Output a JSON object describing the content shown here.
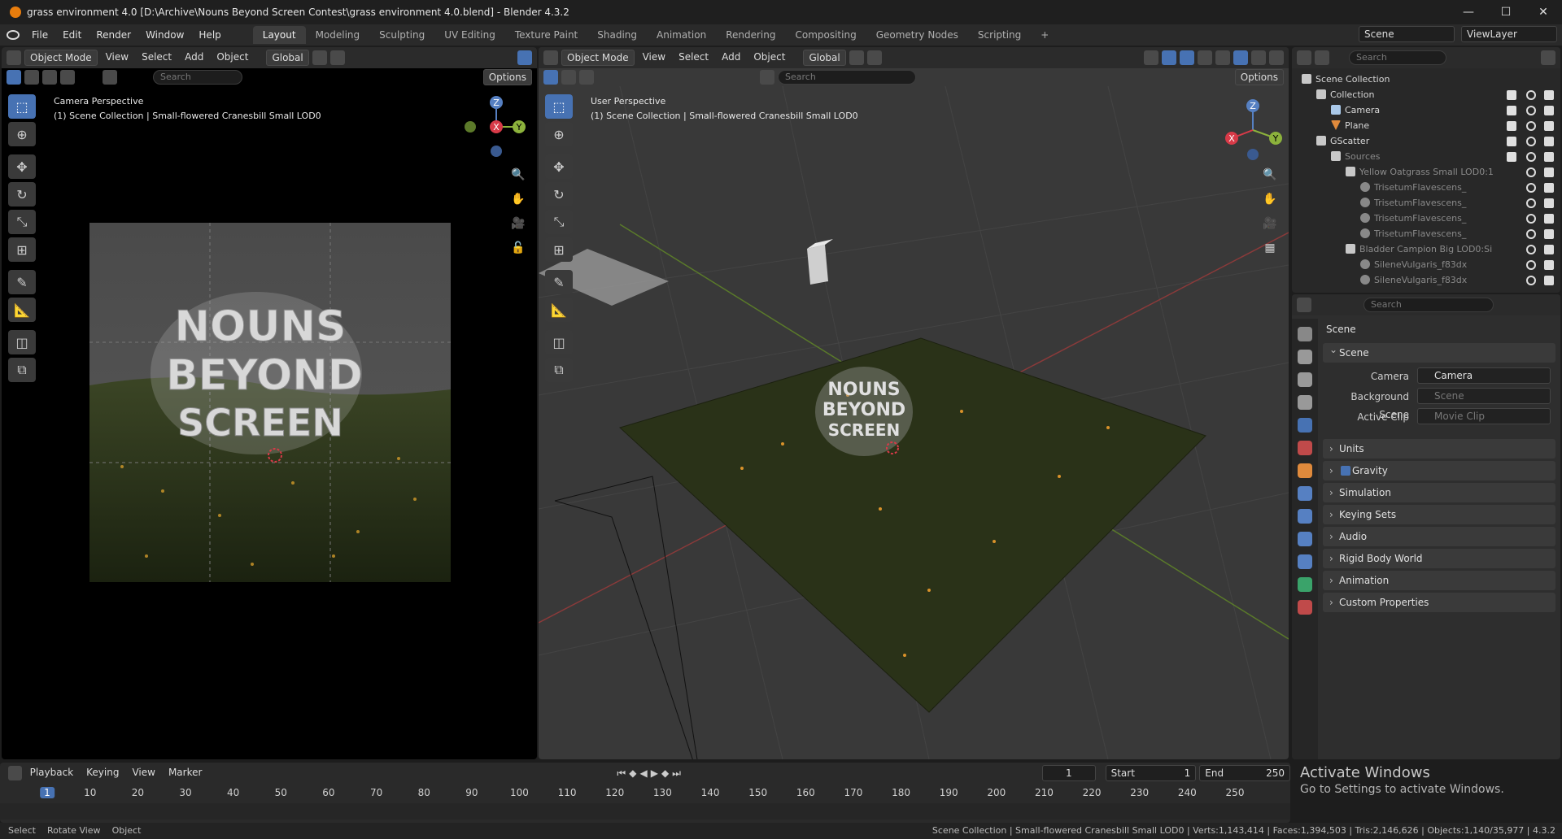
{
  "window": {
    "title": "grass environment 4.0 [D:\\Archive\\Nouns Beyond Screen Contest\\grass environment 4.0.blend] - Blender 4.3.2",
    "minimize": "—",
    "maximize": "☐",
    "close": "✕"
  },
  "menu": [
    "File",
    "Edit",
    "Render",
    "Window",
    "Help"
  ],
  "workspaces": [
    "Layout",
    "Modeling",
    "Sculpting",
    "UV Editing",
    "Texture Paint",
    "Shading",
    "Animation",
    "Rendering",
    "Compositing",
    "Geometry Nodes",
    "Scripting"
  ],
  "workspace_add": "+",
  "scene_field": "Scene",
  "viewlayer_field": "ViewLayer",
  "left_viewport": {
    "mode": "Object Mode",
    "menus": [
      "View",
      "Select",
      "Add",
      "Object"
    ],
    "orientation": "Global",
    "search_placeholder": "Search",
    "options": "Options",
    "perspective": "Camera Perspective",
    "context": "(1) Scene Collection | Small-flowered Cranesbill Small LOD0",
    "gizmo": {
      "z": "Z",
      "y": "Y",
      "x": "X"
    }
  },
  "right_viewport": {
    "mode": "Object Mode",
    "menus": [
      "View",
      "Select",
      "Add",
      "Object"
    ],
    "orientation": "Global",
    "search_placeholder": "Search",
    "options": "Options",
    "perspective": "User Perspective",
    "context": "(1) Scene Collection | Small-flowered Cranesbill Small LOD0",
    "gizmo": {
      "z": "Z",
      "y": "Y",
      "x": "X"
    }
  },
  "artwork_text": [
    "NOUNS",
    "BEYOND",
    "SCREEN"
  ],
  "outliner": {
    "search_placeholder": "Search",
    "rows": [
      {
        "label": "Scene Collection",
        "indent": 0,
        "icon": "col",
        "dim": false
      },
      {
        "label": "Collection",
        "indent": 1,
        "icon": "col",
        "dim": false
      },
      {
        "label": "Camera",
        "indent": 2,
        "icon": "cam",
        "dim": false
      },
      {
        "label": "Plane",
        "indent": 2,
        "icon": "mesh",
        "dim": false
      },
      {
        "label": "GScatter",
        "indent": 1,
        "icon": "col",
        "dim": false
      },
      {
        "label": "Sources",
        "indent": 2,
        "icon": "col",
        "dim": true
      },
      {
        "label": "Yellow Oatgrass Small LOD0:1",
        "indent": 3,
        "icon": "col",
        "dim": true
      },
      {
        "label": "TrisetumFlavescens_",
        "indent": 4,
        "icon": "link",
        "dim": true
      },
      {
        "label": "TrisetumFlavescens_",
        "indent": 4,
        "icon": "link",
        "dim": true
      },
      {
        "label": "TrisetumFlavescens_",
        "indent": 4,
        "icon": "link",
        "dim": true
      },
      {
        "label": "TrisetumFlavescens_",
        "indent": 4,
        "icon": "link",
        "dim": true
      },
      {
        "label": "Bladder Campion Big LOD0:Si",
        "indent": 3,
        "icon": "col",
        "dim": true
      },
      {
        "label": "SileneVulgaris_f83dx",
        "indent": 4,
        "icon": "link",
        "dim": true
      },
      {
        "label": "SileneVulgaris_f83dx",
        "indent": 4,
        "icon": "link",
        "dim": true
      }
    ]
  },
  "properties": {
    "search_placeholder": "Search",
    "context": "Scene",
    "panel_scene": "Scene",
    "camera_label": "Camera",
    "camera_value": "Camera",
    "bg_label": "Background Scene",
    "bg_placeholder": "Scene",
    "clip_label": "Active Clip",
    "clip_placeholder": "Movie Clip",
    "panels": [
      "Units",
      "Gravity",
      "Simulation",
      "Keying Sets",
      "Audio",
      "Rigid Body World",
      "Animation",
      "Custom Properties"
    ]
  },
  "timeline": {
    "menus": [
      "Playback",
      "Keying",
      "View",
      "Marker"
    ],
    "current_frame": "1",
    "start_label": "Start",
    "start": "1",
    "end_label": "End",
    "end": "250",
    "ticks": [
      "1",
      "10",
      "20",
      "30",
      "40",
      "50",
      "60",
      "70",
      "80",
      "90",
      "100",
      "110",
      "120",
      "130",
      "140",
      "150",
      "160",
      "170",
      "180",
      "190",
      "200",
      "210",
      "220",
      "230",
      "240",
      "250"
    ]
  },
  "watermark": {
    "title": "Activate Windows",
    "subtitle": "Go to Settings to activate Windows."
  },
  "status": {
    "select": "Select",
    "rotate": "Rotate View",
    "object": "Object",
    "stats": "Scene Collection | Small-flowered Cranesbill Small LOD0 | Verts:1,143,414 | Faces:1,394,503 | Tris:2,146,626 | Objects:1,140/35,977 | 4.3.2"
  }
}
